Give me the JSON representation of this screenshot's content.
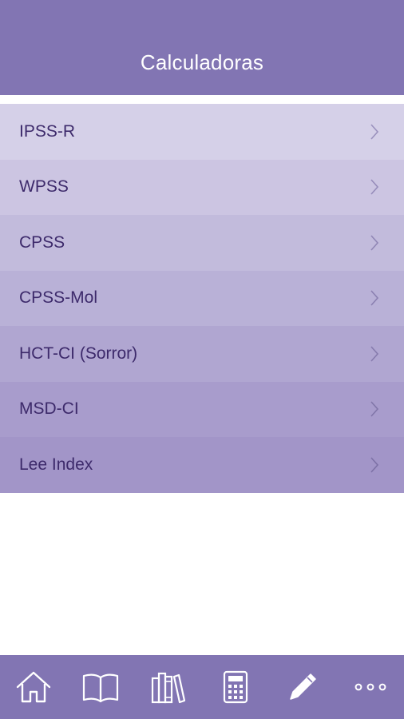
{
  "header": {
    "title": "Calculadoras"
  },
  "list": {
    "items": [
      {
        "label": "IPSS-R",
        "bg": "#d5d0e8"
      },
      {
        "label": "WPSS",
        "bg": "#ccc5e2"
      },
      {
        "label": "CPSS",
        "bg": "#c2bbdc"
      },
      {
        "label": "CPSS-Mol",
        "bg": "#b9b1d7"
      },
      {
        "label": "HCT-CI (Sorror)",
        "bg": "#b0a6d1"
      },
      {
        "label": "MSD-CI",
        "bg": "#a89ccc"
      },
      {
        "label": "Lee Index",
        "bg": "#a295c8"
      }
    ],
    "chevron_icon": "chevron-right-icon",
    "text_color": "#3d2a6b"
  },
  "tabbar": {
    "background": "#8275b3",
    "tabs": [
      {
        "icon": "home-icon"
      },
      {
        "icon": "open-book-icon"
      },
      {
        "icon": "library-books-icon"
      },
      {
        "icon": "calculator-icon"
      },
      {
        "icon": "pencil-icon"
      },
      {
        "icon": "more-dots-icon"
      }
    ]
  },
  "colors": {
    "brand": "#8275b3",
    "accent_text": "#3d2a6b"
  }
}
